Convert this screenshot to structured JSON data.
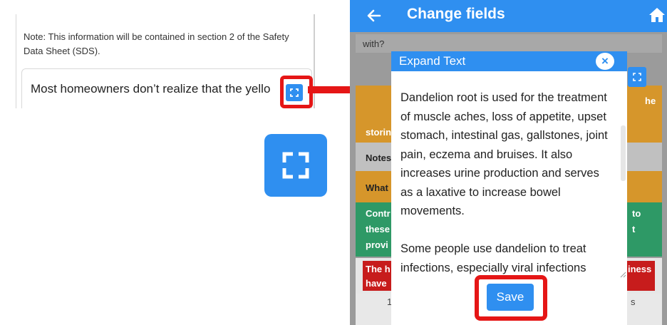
{
  "left": {
    "note": "Note: This information will be contained in section 2 of the Safety Data Sheet (SDS).",
    "field_text": "Most homeowners don’t realize that the yello"
  },
  "phone": {
    "title": "Change fields",
    "bg_question": "with?",
    "bg_labels": {
      "orange1_right": "he",
      "orange1_bottom": "storin",
      "gray": "Notes",
      "orange2": "What",
      "green_lines": [
        "Contr",
        "these",
        "provi"
      ],
      "green_right": [
        "to",
        "t"
      ],
      "red_lines": [
        "The h",
        "have"
      ],
      "red_right": "iness",
      "bottom_left": "1",
      "bottom_right": "s"
    }
  },
  "dialog": {
    "title": "Expand Text",
    "close_glyph": "×",
    "paragraph1": "Dandelion root is used for the treatment of muscle aches, loss of appetite, upset stomach, intestinal gas, gallstones, joint pain, eczema and bruises. It also increases urine production and serves as a laxative to increase bowel movements.",
    "paragraph2": "Some people use dandelion to treat infections, especially viral infections",
    "save_label": "Save"
  },
  "colors": {
    "accent": "#2f8ff0",
    "highlight": "#e51616",
    "orange": "#d6962b",
    "green": "#2e9966",
    "red": "#c71c1c"
  }
}
